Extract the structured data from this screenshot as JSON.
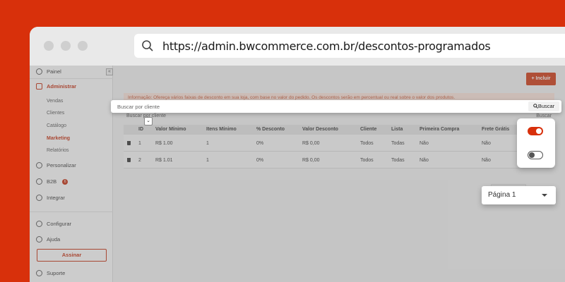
{
  "browser": {
    "url": "https://admin.bwcommerce.com.br/descontos-programados"
  },
  "sidebar": {
    "collapse": "«",
    "items": [
      {
        "label": "Painel"
      },
      {
        "label": "Administrar"
      },
      {
        "label": "Personalizar"
      },
      {
        "label": "B2B",
        "badge": "6"
      },
      {
        "label": "Integrar"
      },
      {
        "label": "Configurar"
      },
      {
        "label": "Ajuda"
      },
      {
        "label": "Suporte"
      }
    ],
    "subitems": [
      "Vendas",
      "Clientes",
      "Catálogo",
      "Marketing",
      "Relatórios"
    ],
    "assinar": "Assinar"
  },
  "main": {
    "incluir": "+ Incluir",
    "info": "Informação: Ofereça vários faixas de desconto em sua loja, com base no valor do pedido. Os descontos serão em percentual ou real sobre o valor dos produtos.",
    "search_placeholder": "Buscar por cliente",
    "search_button": "Buscar",
    "columns": [
      "ID",
      "Valor Mínimo",
      "Itens Mínimo",
      "% Desconto",
      "Valor Desconto",
      "Cliente",
      "Lista",
      "Primeira Compra",
      "Frete Grátis"
    ],
    "rows": [
      [
        "1",
        "R$ 1.00",
        "1",
        "0%",
        "R$ 0,00",
        "Todos",
        "Todas",
        "Não",
        "Não"
      ],
      [
        "2",
        "R$ 1.01",
        "1",
        "0%",
        "R$ 0,00",
        "Todos",
        "Todas",
        "Não",
        "Não"
      ]
    ],
    "sort_icon": "⌄"
  },
  "overlay": {
    "search_placeholder": "Buscar por cliente",
    "search_button": "Buscar",
    "toggle_on": true,
    "toggle_off": false,
    "page_select": "Página 1"
  },
  "colors": {
    "brand": "#d8300b",
    "accent": "#c62a0a"
  }
}
